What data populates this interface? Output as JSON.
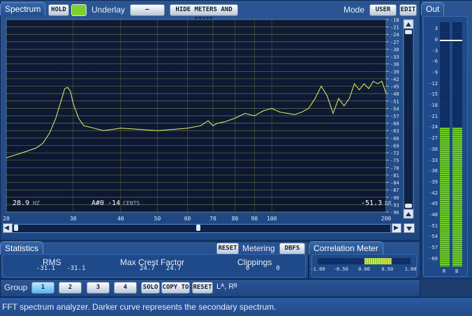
{
  "spectrum": {
    "tab_label": "Spectrum",
    "hold_label": "HOLD",
    "underlay_label": "Underlay",
    "underlay_value": "—",
    "hide_meters_label": "HIDE METERS AND STATS",
    "mode_label": "Mode",
    "mode_value": "USER",
    "edit_label": "EDIT",
    "hold_indicator_color": "#7ecf2a",
    "curve_color": "#e8f26a",
    "readout": {
      "freq_value": "28.9",
      "freq_unit": "HZ",
      "note": "A#0",
      "cents_value": "-14",
      "cents_unit": "CENTS",
      "level_value": "-51.3",
      "level_unit": "DB"
    },
    "x_ticks": [
      "20",
      "30",
      "40",
      "50",
      "60",
      "70",
      "80",
      "90",
      "100",
      "200"
    ],
    "y_ticks": [
      "-18",
      "-21",
      "-24",
      "-27",
      "-30",
      "-33",
      "-36",
      "-39",
      "-42",
      "-45",
      "-48",
      "-51",
      "-54",
      "-57",
      "-60",
      "-63",
      "-66",
      "-69",
      "-72",
      "-75",
      "-78",
      "-81",
      "-84",
      "-87",
      "-90",
      "-93",
      "-96"
    ]
  },
  "chart_data": {
    "type": "line",
    "x_scale": "log",
    "xlim": [
      20,
      200
    ],
    "ylim": [
      -96,
      -18
    ],
    "series": [
      {
        "x": [
          20,
          22,
          24,
          25,
          26,
          27,
          28,
          28.5,
          29,
          29.5,
          30,
          31,
          32,
          34,
          36,
          38,
          40,
          45,
          50,
          55,
          60,
          65,
          68,
          70,
          72,
          75,
          80,
          85,
          90,
          95,
          100,
          105,
          110,
          115,
          120,
          125,
          130,
          135,
          140,
          145,
          150,
          155,
          160,
          165,
          170,
          175,
          180,
          185,
          190,
          195,
          200
        ],
        "y": [
          -74,
          -72,
          -70,
          -68,
          -64,
          -58,
          -50,
          -46,
          -45.5,
          -47,
          -52,
          -58,
          -61,
          -62,
          -63,
          -62.5,
          -62,
          -62.5,
          -63,
          -62.5,
          -62,
          -61,
          -59,
          -61,
          -60,
          -59.5,
          -58,
          -56,
          -57,
          -55,
          -54,
          -55.5,
          -56,
          -56.5,
          -55.5,
          -54,
          -50,
          -45,
          -49,
          -56,
          -50,
          -53,
          -50,
          -44,
          -46.5,
          -44,
          -46,
          -43,
          -44,
          -43,
          -48
        ]
      }
    ]
  },
  "scrollbar": {
    "left_arrow": "◀",
    "right_arrow": "▶"
  },
  "statistics": {
    "tab_label": "Statistics",
    "reset_label": "RESET",
    "metering_label": "Metering",
    "metering_value": "DBFS",
    "rms_label": "RMS",
    "rms_values": "-31.1   -31.1",
    "crest_label": "Max Crest Factor",
    "crest_values": "24.7   24.7",
    "clippings_label": "Clippings",
    "clippings_values": "0       0"
  },
  "correlation": {
    "tab_label": "Correlation Meter",
    "ticks": [
      "-1.00",
      "-0.50",
      "0.00",
      "0.50",
      "1.00"
    ],
    "value": 0.05
  },
  "group": {
    "label": "Group",
    "buttons": [
      "1",
      "2",
      "3",
      "4"
    ],
    "solo_label": "SOLO",
    "copyto_label": "COPY TO",
    "reset_label": "RESET",
    "channels": "Lᴬ, Rᴮ"
  },
  "out": {
    "tab_label": "Out",
    "ticks": [
      "3",
      "0",
      "-3",
      "-6",
      "-9",
      "-12",
      "-15",
      "-18",
      "-21",
      "-24",
      "-27",
      "-30",
      "-33",
      "-36",
      "-39",
      "-42",
      "-45",
      "-48",
      "-51",
      "-54",
      "-57",
      "-60"
    ],
    "channel_labels": [
      "R",
      "B"
    ],
    "level_db": -24,
    "peak_db": 0,
    "meter_color": "#6fcf2a"
  },
  "status_bar": {
    "text": "FFT spectrum analyzer. Darker curve represents the secondary spectrum."
  }
}
